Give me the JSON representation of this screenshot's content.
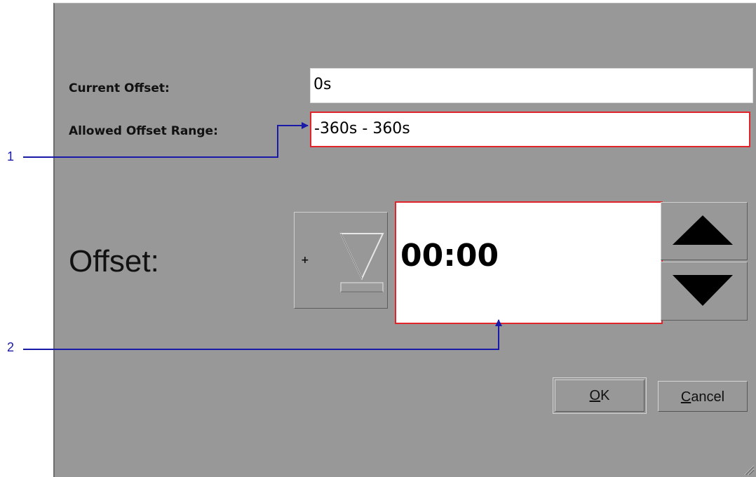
{
  "dialog": {
    "current_offset_label": "Current Offset:",
    "current_offset_value": "0s",
    "allowed_range_label": "Allowed Offset Range:",
    "allowed_range_value": "-360s - 360s",
    "offset_label": "Offset:",
    "sign_symbol": "+",
    "time_value": "00:00",
    "ok_button": {
      "mnemonic": "O",
      "rest": "K"
    },
    "cancel_button": {
      "mnemonic": "C",
      "rest": "ancel"
    }
  },
  "callouts": [
    {
      "number": "1"
    },
    {
      "number": "2"
    }
  ],
  "icons": {
    "sign_toggle": "triangle-down-outline-icon",
    "increment": "triangle-up-icon",
    "decrement": "triangle-down-icon",
    "resize_grip": "resize-grip-icon"
  },
  "colors": {
    "dialog_bg": "#989898",
    "highlight": "#e0242a",
    "callout": "#1a1aa8"
  }
}
